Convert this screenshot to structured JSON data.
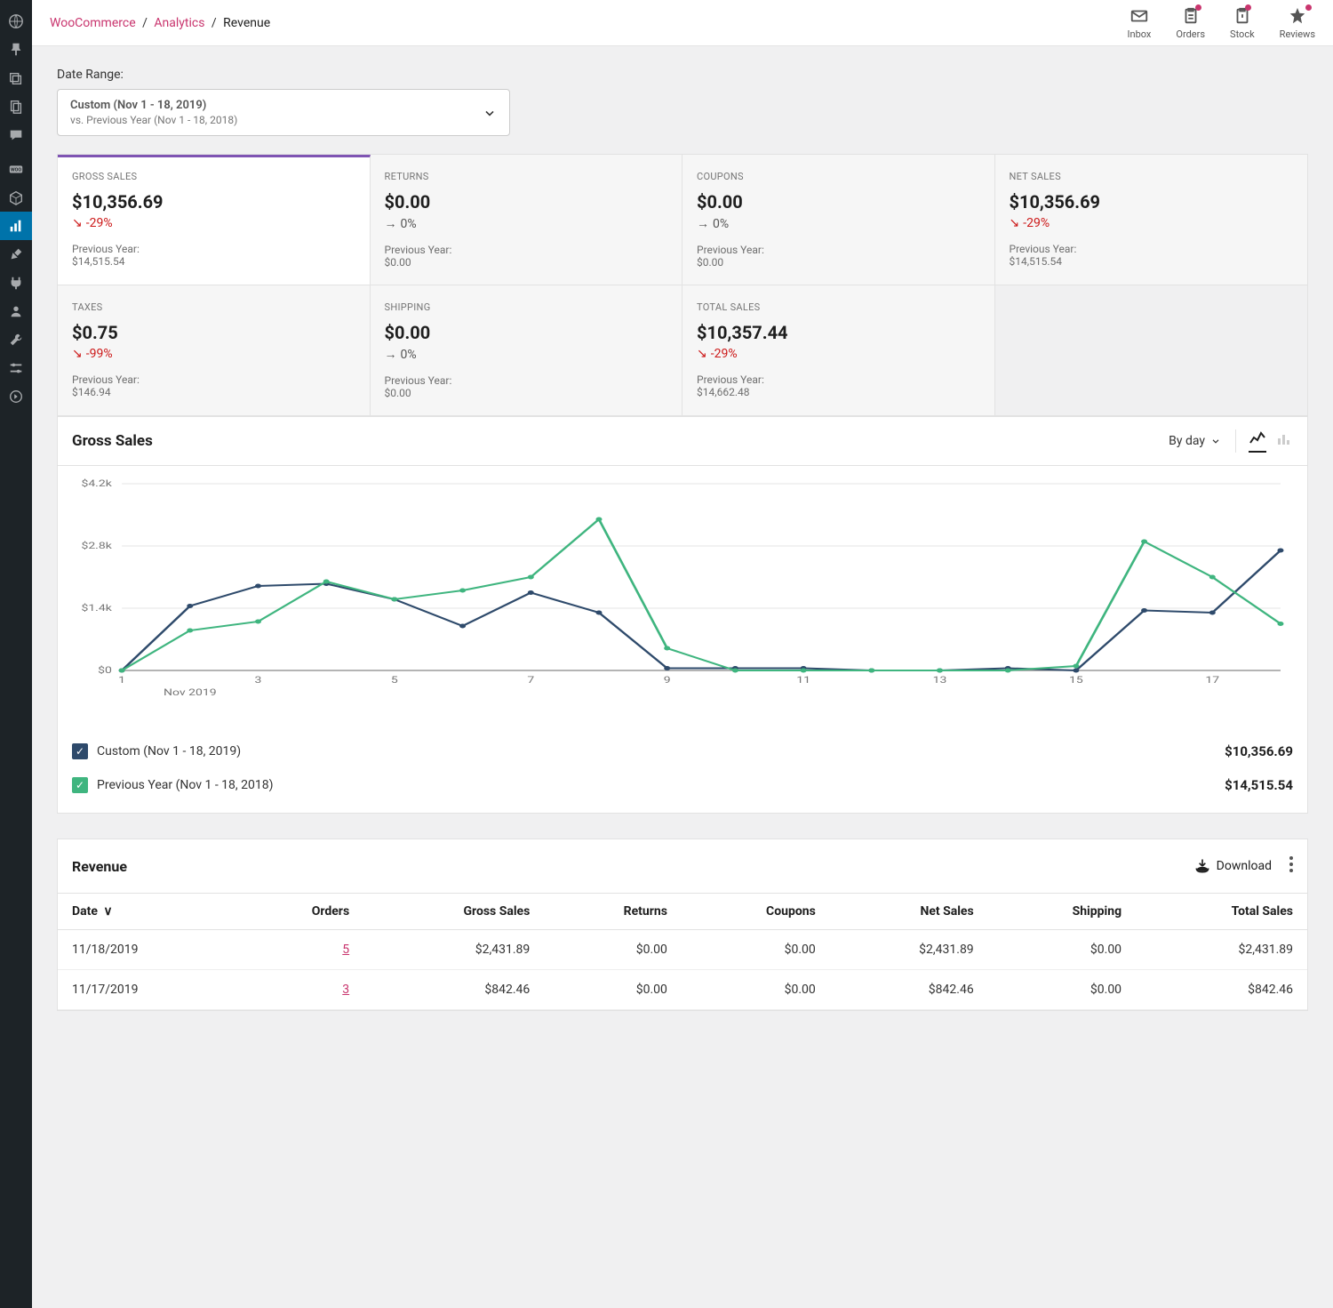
{
  "breadcrumb": {
    "root": "WooCommerce",
    "section": "Analytics",
    "page": "Revenue"
  },
  "top_actions": {
    "inbox": "Inbox",
    "orders": "Orders",
    "stock": "Stock",
    "reviews": "Reviews"
  },
  "date_range": {
    "label": "Date Range:",
    "primary": "Custom (Nov 1 - 18, 2019)",
    "secondary": "vs. Previous Year (Nov 1 - 18, 2018)"
  },
  "stats": [
    {
      "label": "GROSS SALES",
      "value": "$10,356.69",
      "delta": "-29%",
      "dir": "down",
      "prev_label": "Previous Year:",
      "prev_value": "$14,515.54",
      "active": true
    },
    {
      "label": "RETURNS",
      "value": "$0.00",
      "delta": "0%",
      "dir": "flat",
      "prev_label": "Previous Year:",
      "prev_value": "$0.00"
    },
    {
      "label": "COUPONS",
      "value": "$0.00",
      "delta": "0%",
      "dir": "flat",
      "prev_label": "Previous Year:",
      "prev_value": "$0.00"
    },
    {
      "label": "NET SALES",
      "value": "$10,356.69",
      "delta": "-29%",
      "dir": "down",
      "prev_label": "Previous Year:",
      "prev_value": "$14,515.54"
    },
    {
      "label": "TAXES",
      "value": "$0.75",
      "delta": "-99%",
      "dir": "down",
      "prev_label": "Previous Year:",
      "prev_value": "$146.94"
    },
    {
      "label": "SHIPPING",
      "value": "$0.00",
      "delta": "0%",
      "dir": "flat",
      "prev_label": "Previous Year:",
      "prev_value": "$0.00"
    },
    {
      "label": "TOTAL SALES",
      "value": "$10,357.44",
      "delta": "-29%",
      "dir": "down",
      "prev_label": "Previous Year:",
      "prev_value": "$14,662.48"
    }
  ],
  "chart": {
    "title": "Gross Sales",
    "interval": "By day",
    "legend": [
      {
        "label": "Custom (Nov 1 - 18, 2019)",
        "color": "#2e4a6b",
        "total": "$10,356.69"
      },
      {
        "label": "Previous Year (Nov 1 - 18, 2018)",
        "color": "#3fb57f",
        "total": "$14,515.54"
      }
    ]
  },
  "chart_data": {
    "type": "line",
    "xlabel": "Nov 2019",
    "ylabel": "",
    "ylim": [
      0,
      4200
    ],
    "y_ticks": [
      "$0",
      "$1.4k",
      "$2.8k",
      "$4.2k"
    ],
    "x_ticks": [
      "1",
      "3",
      "5",
      "7",
      "9",
      "11",
      "13",
      "15",
      "17"
    ],
    "categories": [
      1,
      2,
      3,
      4,
      5,
      6,
      7,
      8,
      9,
      10,
      11,
      12,
      13,
      14,
      15,
      16,
      17,
      18
    ],
    "series": [
      {
        "name": "Custom (Nov 1 - 18, 2019)",
        "color": "#2e4a6b",
        "values": [
          0,
          1450,
          1900,
          1950,
          1600,
          1000,
          1750,
          1300,
          50,
          50,
          50,
          0,
          0,
          50,
          0,
          1350,
          1300,
          2700
        ]
      },
      {
        "name": "Previous Year (Nov 1 - 18, 2018)",
        "color": "#3fb57f",
        "values": [
          0,
          900,
          1100,
          2000,
          1600,
          1800,
          2100,
          3400,
          500,
          0,
          0,
          0,
          0,
          0,
          100,
          2900,
          2100,
          1050
        ]
      }
    ]
  },
  "table": {
    "title": "Revenue",
    "download": "Download",
    "columns": [
      "Date",
      "Orders",
      "Gross Sales",
      "Returns",
      "Coupons",
      "Net Sales",
      "Shipping",
      "Total Sales"
    ],
    "rows": [
      {
        "date": "11/18/2019",
        "orders": "5",
        "gross": "$2,431.89",
        "returns": "$0.00",
        "coupons": "$0.00",
        "net": "$2,431.89",
        "shipping": "$0.00",
        "total": "$2,431.89"
      },
      {
        "date": "11/17/2019",
        "orders": "3",
        "gross": "$842.46",
        "returns": "$0.00",
        "coupons": "$0.00",
        "net": "$842.46",
        "shipping": "$0.00",
        "total": "$842.46"
      }
    ]
  }
}
